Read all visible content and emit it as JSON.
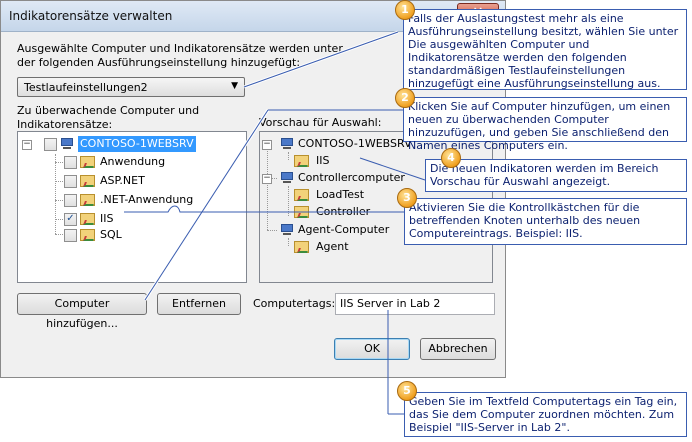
{
  "window": {
    "title": "Indikatorensätze verwalten",
    "close_glyph": "✕"
  },
  "instructions": {
    "line1": "Ausgewählte Computer und Indikatorensätze werden unter",
    "line2": "der folgenden Ausführungseinstellung hinzugefügt:"
  },
  "run_settings": {
    "selected": "Testlaufeinstellungen2"
  },
  "monitor_label": {
    "line1": "Zu überwachende Computer und",
    "line2": "Indikatorensätze:"
  },
  "monitor_tree": {
    "root": "CONTOSO-1WEBSRV",
    "items": [
      {
        "label": "Anwendung",
        "checked": false
      },
      {
        "label": "ASP.NET",
        "checked": false
      },
      {
        "label": ".NET-Anwendung",
        "checked": false
      },
      {
        "label": "IIS",
        "checked": true
      },
      {
        "label": "SQL",
        "checked": false
      }
    ]
  },
  "preview": {
    "label": "Vorschau für Auswahl:",
    "nodes": [
      {
        "label": "CONTOSO-1WEBSRV",
        "children": [
          "IIS"
        ]
      },
      {
        "label": "Controllercomputer",
        "children": [
          "LoadTest",
          "Controller"
        ]
      },
      {
        "label": "Agent-Computer",
        "children": [
          "Agent"
        ]
      }
    ]
  },
  "buttons": {
    "add_computer": "Computer hinzufügen...",
    "remove": "Entfernen",
    "ok": "OK",
    "cancel": "Abbrechen"
  },
  "computer_tags": {
    "label": "Computertags:",
    "value": "IIS Server in Lab 2"
  },
  "callouts": [
    {
      "number": "1",
      "text": "Falls der Auslastungstest mehr als eine Ausführungseinstellung besitzt, wählen Sie unter Die ausgewählten Computer und Indikatorensätze werden den folgenden standardmäßigen Testlaufeinstellungen hinzugefügt eine Ausführungseinstellung aus."
    },
    {
      "number": "2",
      "text": "Klicken Sie auf Computer hinzufügen, um einen neuen zu überwachenden Computer hinzuzufügen, und geben Sie anschließend den Namen eines Computers ein."
    },
    {
      "number": "4",
      "text": "Die neuen Indikatoren werden im Bereich Vorschau für Auswahl angezeigt."
    },
    {
      "number": "3",
      "text": "Aktivieren Sie die Kontrollkästchen für die betreffenden Knoten unterhalb des neuen Computereintrags. Beispiel: IIS."
    },
    {
      "number": "5",
      "text": "Geben Sie im Textfeld Computertags ein Tag ein, das Sie dem Computer zuordnen möchten. Zum Beispiel \"IIS-Server in Lab 2\"."
    }
  ],
  "colors": {
    "callout_border": "#3a5db0",
    "callout_text": "#0a1f6e",
    "selection": "#3399ff"
  }
}
